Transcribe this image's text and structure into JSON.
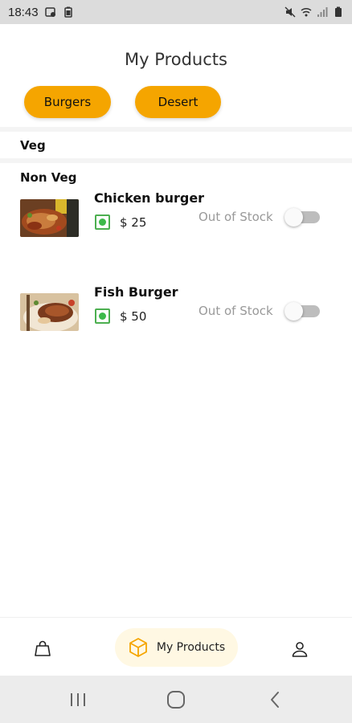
{
  "status_bar": {
    "time": "18:43",
    "icons_left": [
      "screen-record-icon",
      "battery-saver-icon"
    ],
    "icons_right": [
      "mute-icon",
      "wifi-icon",
      "signal-icon",
      "battery-icon"
    ]
  },
  "header": {
    "title": "My Products"
  },
  "categories": [
    {
      "label": "Burgers"
    },
    {
      "label": "Desert"
    }
  ],
  "sections": {
    "veg_label": "Veg",
    "non_veg_label": "Non Veg"
  },
  "products": [
    {
      "name": "Chicken burger",
      "price": "$ 25",
      "stock_label": "Out of Stock",
      "in_stock": false,
      "image": "chicken-burger-photo"
    },
    {
      "name": "Fish Burger",
      "price": "$ 50",
      "stock_label": "Out of Stock",
      "in_stock": false,
      "image": "fish-burger-photo"
    }
  ],
  "bottom_nav": {
    "items": [
      {
        "icon": "shopping-bag-icon",
        "label": ""
      },
      {
        "icon": "box-icon",
        "label": "My Products",
        "active": true
      },
      {
        "icon": "user-icon",
        "label": ""
      }
    ]
  },
  "colors": {
    "accent": "#f5a500",
    "veg_green": "#3cb94a",
    "muted_text": "#999999",
    "active_nav_bg": "#fff8e3"
  }
}
